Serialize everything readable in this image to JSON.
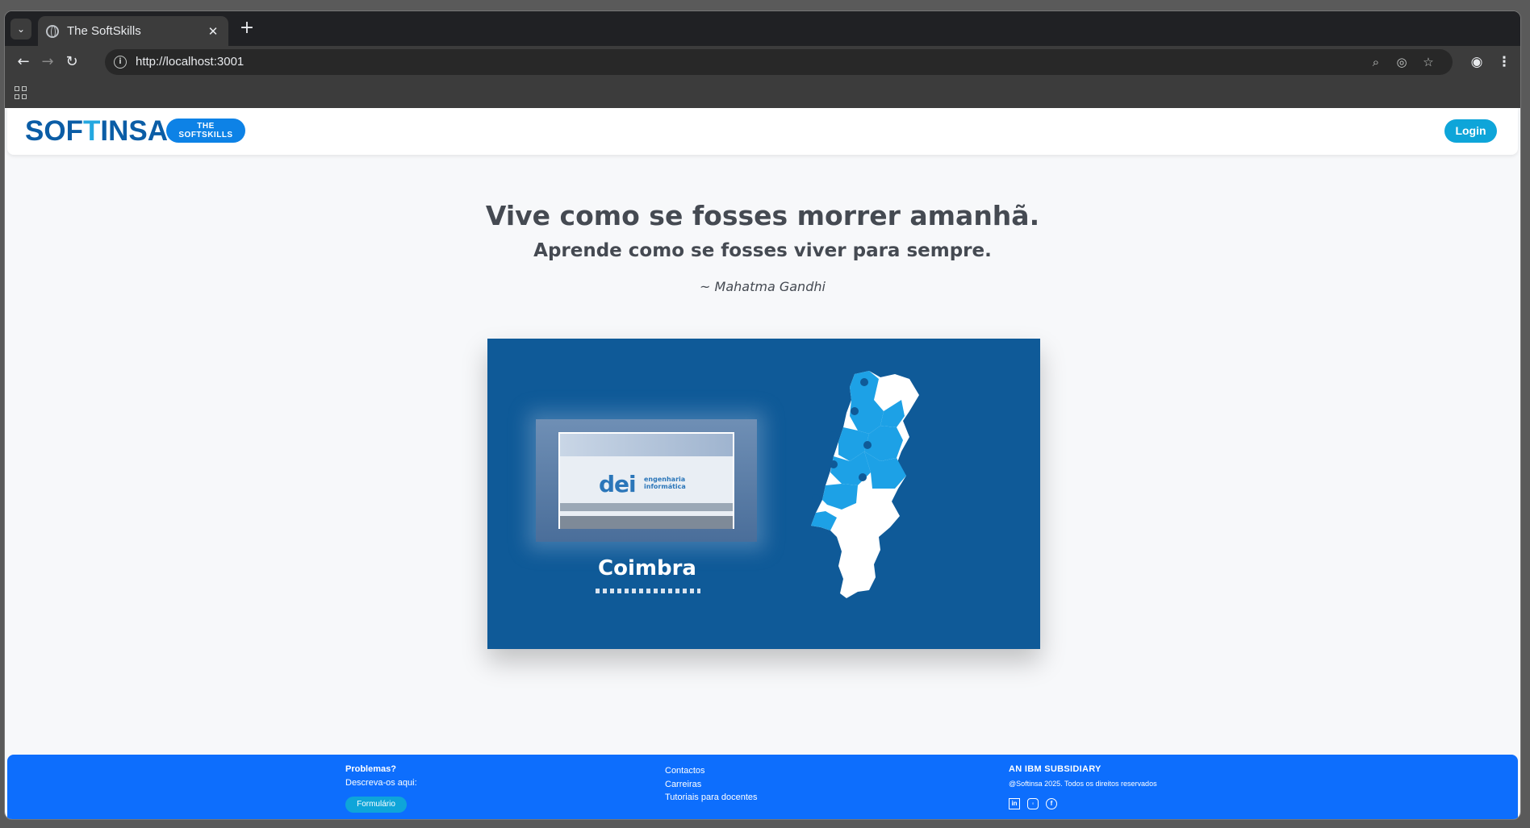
{
  "browser": {
    "tab_title": "The SoftSkills",
    "tab_close": "✕",
    "new_tab": "+",
    "url": "http://localhost:3001"
  },
  "header": {
    "logo_part1": "SOF",
    "logo_t": "T",
    "logo_part2": "INSA",
    "badge_line1": "THE",
    "badge_line2": "SOFTSKILLS",
    "login_label": "Login"
  },
  "hero": {
    "quote_main": "Vive como se fosses morrer amanhã.",
    "quote_sub": "Aprende como se fosses viver para sempre.",
    "author": "~ Mahatma Gandhi"
  },
  "video": {
    "logo": "dei",
    "logo_sub": "engenharia informática",
    "city": "Coimbra"
  },
  "footer": {
    "problems_title": "Problemas?",
    "problems_desc": "Descreva-os aqui:",
    "form_button": "Formulário",
    "links": [
      "Contactos",
      "Carreiras",
      "Tutoriais para docentes"
    ],
    "ibm_title": "AN IBM SUBSIDIARY",
    "copyright": "@Softinsa 2025. Todos os direitos reservados",
    "social": [
      "linkedin-icon",
      "instagram-icon",
      "facebook-icon"
    ]
  },
  "colors": {
    "brand_dark": "#0b5da6",
    "brand_light": "#24a8e0",
    "footer_blue": "#0d6efd",
    "accent_cyan": "#0ea5d9",
    "video_bg": "#0f5a98"
  }
}
